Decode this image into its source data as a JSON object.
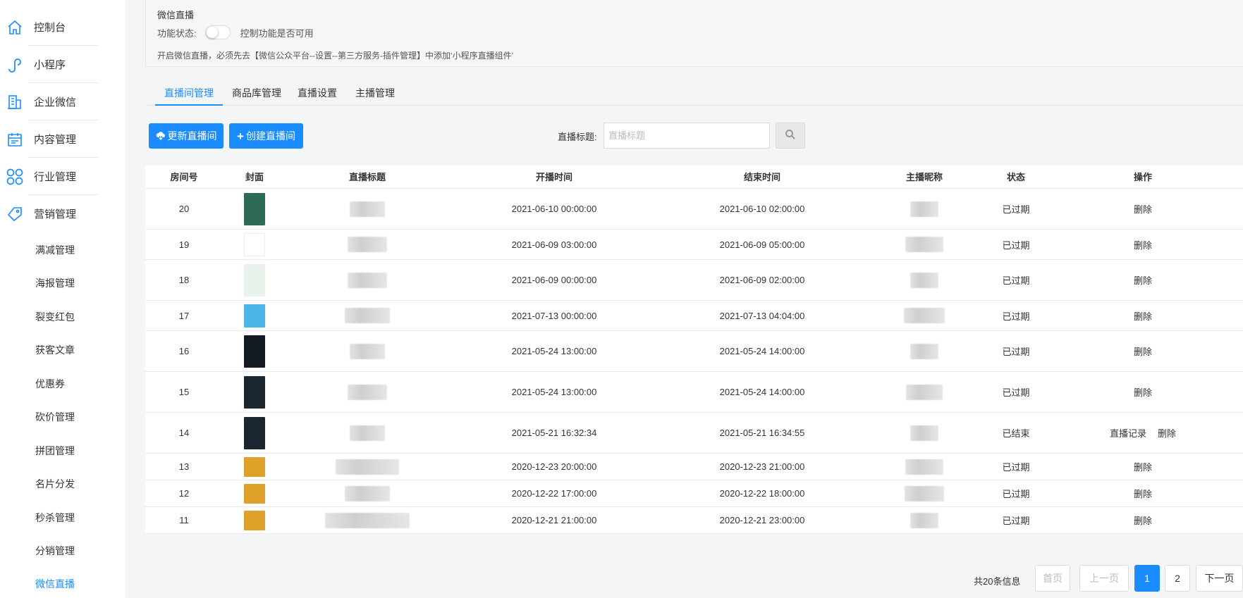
{
  "sidebar": {
    "main_items": [
      {
        "label": "控制台",
        "icon": "home-icon"
      },
      {
        "label": "小程序",
        "icon": "miniprogram-icon"
      },
      {
        "label": "企业微信",
        "icon": "building-icon"
      },
      {
        "label": "内容管理",
        "icon": "calendar-icon"
      },
      {
        "label": "行业管理",
        "icon": "grid-icon"
      },
      {
        "label": "营销管理",
        "icon": "tag-icon"
      }
    ],
    "sub_items": [
      "满减管理",
      "海报管理",
      "裂变红包",
      "获客文章",
      "优惠券",
      "砍价管理",
      "拼团管理",
      "名片分发",
      "秒杀管理",
      "分销管理",
      "微信直播"
    ],
    "active_sub": "微信直播",
    "accent": "#1a8cff"
  },
  "panel": {
    "title": "微信直播",
    "status_label": "功能状态:",
    "status_hint": "控制功能是否可用",
    "toggle_on": false,
    "notice": "开启微信直播，必须先去【微信公众平台--设置--第三方服务-插件管理】中添加‘小程序直播组件’"
  },
  "tabs": [
    {
      "label": "直播间管理",
      "active": true
    },
    {
      "label": "商品库管理",
      "active": false
    },
    {
      "label": "直播设置",
      "active": false
    },
    {
      "label": "主播管理",
      "active": false
    }
  ],
  "toolbar": {
    "refresh_label": "更新直播间",
    "create_label": "创建直播间",
    "search_label": "直播标题:",
    "search_placeholder": "直播标题"
  },
  "table": {
    "headers": [
      "房间号",
      "封面",
      "直播标题",
      "开播时间",
      "结束时间",
      "主播昵称",
      "状态",
      "操作"
    ],
    "rows": [
      {
        "room": "20",
        "start": "2021-06-10 00:00:00",
        "end": "2021-06-10 02:00:00",
        "status": "已过期",
        "ops": [
          "删除"
        ],
        "cover_color": "#2e6b55"
      },
      {
        "room": "19",
        "start": "2021-06-09 03:00:00",
        "end": "2021-06-09 05:00:00",
        "status": "已过期",
        "ops": [
          "删除"
        ],
        "cover_color": "#ffffff"
      },
      {
        "room": "18",
        "start": "2021-06-09 00:00:00",
        "end": "2021-06-09 02:00:00",
        "status": "已过期",
        "ops": [
          "删除"
        ],
        "cover_color": "#e8f2ea"
      },
      {
        "room": "17",
        "start": "2021-07-13 00:00:00",
        "end": "2021-07-13 04:04:00",
        "status": "已过期",
        "ops": [
          "删除"
        ],
        "cover_color": "#4db6e8"
      },
      {
        "room": "16",
        "start": "2021-05-24 13:00:00",
        "end": "2021-05-24 14:00:00",
        "status": "已过期",
        "ops": [
          "删除"
        ],
        "cover_color": "#141a22"
      },
      {
        "room": "15",
        "start": "2021-05-24 13:00:00",
        "end": "2021-05-24 14:00:00",
        "status": "已过期",
        "ops": [
          "删除"
        ],
        "cover_color": "#1c2630"
      },
      {
        "room": "14",
        "start": "2021-05-21 16:32:34",
        "end": "2021-05-21 16:34:55",
        "status": "已结束",
        "ops": [
          "直播记录",
          "删除"
        ],
        "cover_color": "#1c2630"
      },
      {
        "room": "13",
        "start": "2020-12-23 20:00:00",
        "end": "2020-12-23 21:00:00",
        "status": "已过期",
        "ops": [
          "删除"
        ],
        "cover_color": "#e0a12a"
      },
      {
        "room": "12",
        "start": "2020-12-22 17:00:00",
        "end": "2020-12-22 18:00:00",
        "status": "已过期",
        "ops": [
          "删除"
        ],
        "cover_color": "#e0a12a"
      },
      {
        "room": "11",
        "start": "2020-12-21 21:00:00",
        "end": "2020-12-21 23:00:00",
        "status": "已过期",
        "ops": [
          "删除"
        ],
        "cover_color": "#e0a12a"
      }
    ]
  },
  "pagination": {
    "total_text": "共20条信息",
    "first": "首页",
    "prev": "上一页",
    "pages": [
      "1",
      "2"
    ],
    "current": "1",
    "next": "下一页"
  }
}
